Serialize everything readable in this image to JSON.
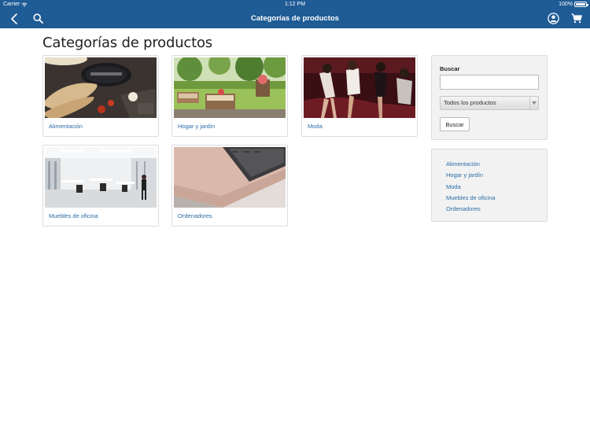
{
  "status_bar": {
    "carrier": "Carrier",
    "time": "1:12 PM",
    "battery": "100%"
  },
  "nav": {
    "title": "Categorías de productos"
  },
  "page_title": "Categorías de productos",
  "cards": [
    {
      "label": "Alimentación"
    },
    {
      "label": "Hogar y jardín"
    },
    {
      "label": "Moda"
    },
    {
      "label": "Muebles de oficina"
    },
    {
      "label": "Ordenadores"
    }
  ],
  "search": {
    "label": "Buscar",
    "input_value": "",
    "select_value": "Todos los productos",
    "button": "Buscar"
  },
  "categories": [
    "Alimentación",
    "Hogar y jardín",
    "Moda",
    "Muebles de oficina",
    "Ordenadores"
  ],
  "colors": {
    "header": "#1f5b95",
    "link": "#2a6da6",
    "panel": "#f2f2f2"
  }
}
